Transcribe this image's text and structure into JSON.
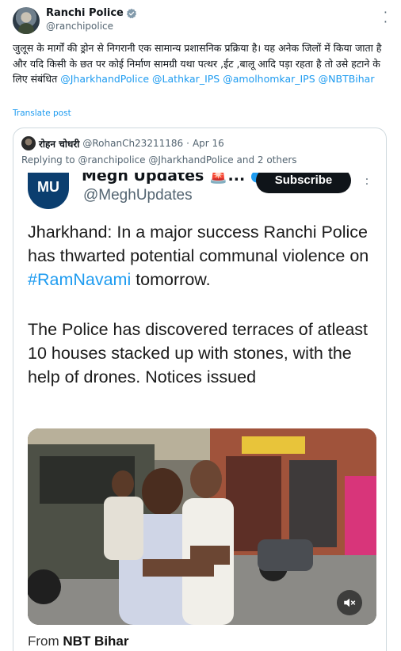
{
  "author": {
    "name": "Ranchi Police",
    "handle": "@ranchipolice"
  },
  "tweet": {
    "text": "जुलूस के मार्गों की ड्रोन से निगरानी एक सामान्य प्रशासनिक प्रक्रिया है। यह अनेक जिलों में किया जाता है और यदि किसी के छत पर कोई निर्माण सामग्री यथा पत्थर ,ईट ,बालू आदि पड़ा रहता है तो उसे हटाने के लिए संबंधित ",
    "mentions": [
      "@JharkhandPolice",
      "@Lathkar_IPS",
      "@amolhomkar_IPS",
      "@NBTBihar"
    ],
    "translate_label": "Translate post"
  },
  "quoted": {
    "name": "रोहन चोधरी",
    "handle": "@RohanCh23211186",
    "separator": "·",
    "date": "Apr 16",
    "replying_to": "Replying to @ranchipolice @JharkhandPolice and 2 others"
  },
  "media_card": {
    "logo_text": "MU",
    "channel_title": "Megh Updates",
    "channel_suffix": "🚨...",
    "channel_handle": "@MeghUpdates",
    "subscribe_label": "Subscribe",
    "headline_before_tag": "Jharkhand: In a major success  Ranchi Police has thwarted potential communal violence on ",
    "hashtag": "#RamNavami",
    "headline_after_tag": " tomorrow.",
    "body": "The Police has discovered terraces of atleast 10 houses stacked up with stones, with the help of drones. Notices issued",
    "from_prefix": "From ",
    "from_source": "NBT Bihar"
  },
  "icons": {
    "verified": "verified-badge-icon",
    "more": "more-icon",
    "mute": "mute-icon"
  },
  "colors": {
    "link": "#1d9bf0",
    "text": "#0f1419",
    "muted": "#536471",
    "border": "#cfd9de"
  }
}
